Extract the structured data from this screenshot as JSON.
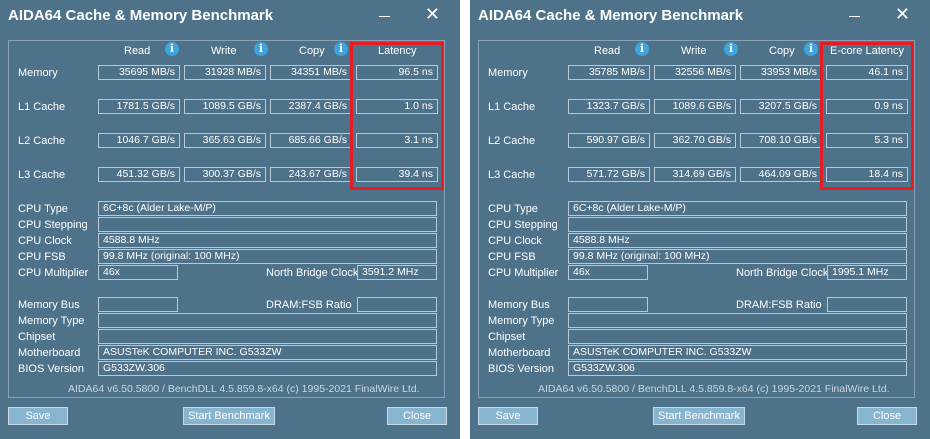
{
  "windows": [
    {
      "title": "AIDA64 Cache & Memory Benchmark",
      "columns": {
        "read": "Read",
        "write": "Write",
        "copy": "Copy",
        "latency": "Latency"
      },
      "rows": [
        {
          "label": "Memory",
          "read": "35695 MB/s",
          "write": "31928 MB/s",
          "copy": "34351 MB/s",
          "latency": "96.5 ns"
        },
        {
          "label": "L1 Cache",
          "read": "1781.5 GB/s",
          "write": "1089.5 GB/s",
          "copy": "2387.4 GB/s",
          "latency": "1.0 ns"
        },
        {
          "label": "L2 Cache",
          "read": "1046.7 GB/s",
          "write": "365.63 GB/s",
          "copy": "685.66 GB/s",
          "latency": "3.1 ns"
        },
        {
          "label": "L3 Cache",
          "read": "451.32 GB/s",
          "write": "300.37 GB/s",
          "copy": "243.67 GB/s",
          "latency": "39.4 ns"
        }
      ],
      "cpu": {
        "type_label": "CPU Type",
        "type": "6C+8c   (Alder Lake-M/P)",
        "stepping_label": "CPU Stepping",
        "stepping": "",
        "clock_label": "CPU Clock",
        "clock": "4588.8 MHz",
        "fsb_label": "CPU FSB",
        "fsb": "99.8 MHz  (original: 100 MHz)",
        "multiplier_label": "CPU Multiplier",
        "multiplier": "46x",
        "nb_clock_label": "North Bridge Clock",
        "nb_clock": "3591.2 MHz"
      },
      "mem": {
        "bus_label": "Memory Bus",
        "bus": "",
        "dram_fsb_label": "DRAM:FSB Ratio",
        "dram_fsb": "",
        "type_label": "Memory Type",
        "type": "",
        "chipset_label": "Chipset",
        "chipset": "",
        "motherboard_label": "Motherboard",
        "motherboard": "ASUSTeK COMPUTER INC. G533ZW",
        "bios_label": "BIOS Version",
        "bios": "G533ZW.306"
      },
      "footer": "AIDA64 v6.50.5800 / BenchDLL 4.5.859.8-x64  (c) 1995-2021 FinalWire Ltd.",
      "buttons": {
        "save": "Save",
        "start": "Start Benchmark",
        "close": "Close"
      }
    },
    {
      "title": "AIDA64 Cache & Memory Benchmark",
      "columns": {
        "read": "Read",
        "write": "Write",
        "copy": "Copy",
        "latency": "E-core Latency"
      },
      "rows": [
        {
          "label": "Memory",
          "read": "35785 MB/s",
          "write": "32556 MB/s",
          "copy": "33953 MB/s",
          "latency": "46.1 ns"
        },
        {
          "label": "L1 Cache",
          "read": "1323.7 GB/s",
          "write": "1089.6 GB/s",
          "copy": "3207.5 GB/s",
          "latency": "0.9 ns"
        },
        {
          "label": "L2 Cache",
          "read": "590.97 GB/s",
          "write": "362.70 GB/s",
          "copy": "708.10 GB/s",
          "latency": "5.3 ns"
        },
        {
          "label": "L3 Cache",
          "read": "571.72 GB/s",
          "write": "314.69 GB/s",
          "copy": "464.09 GB/s",
          "latency": "18.4 ns"
        }
      ],
      "cpu": {
        "type_label": "CPU Type",
        "type": "6C+8c   (Alder Lake-M/P)",
        "stepping_label": "CPU Stepping",
        "stepping": "",
        "clock_label": "CPU Clock",
        "clock": "4588.8 MHz",
        "fsb_label": "CPU FSB",
        "fsb": "99.8 MHz  (original: 100 MHz)",
        "multiplier_label": "CPU Multiplier",
        "multiplier": "46x",
        "nb_clock_label": "North Bridge Clock",
        "nb_clock": "1995.1 MHz"
      },
      "mem": {
        "bus_label": "Memory Bus",
        "bus": "",
        "dram_fsb_label": "DRAM:FSB Ratio",
        "dram_fsb": "",
        "type_label": "Memory Type",
        "type": "",
        "chipset_label": "Chipset",
        "chipset": "",
        "motherboard_label": "Motherboard",
        "motherboard": "ASUSTeK COMPUTER INC. G533ZW",
        "bios_label": "BIOS Version",
        "bios": "G533ZW.306"
      },
      "footer": "AIDA64 v6.50.5800 / BenchDLL 4.5.859.8-x64  (c) 1995-2021 FinalWire Ltd.",
      "buttons": {
        "save": "Save",
        "start": "Start Benchmark",
        "close": "Close"
      }
    }
  ],
  "icons": {
    "info": "info-icon",
    "minimize": "minimize-icon",
    "close": "close-icon"
  },
  "colors": {
    "window_bg": "#4e7289",
    "highlight": "#e51c23",
    "info_icon": "#3fa4dc",
    "button": "#87b4cf"
  }
}
